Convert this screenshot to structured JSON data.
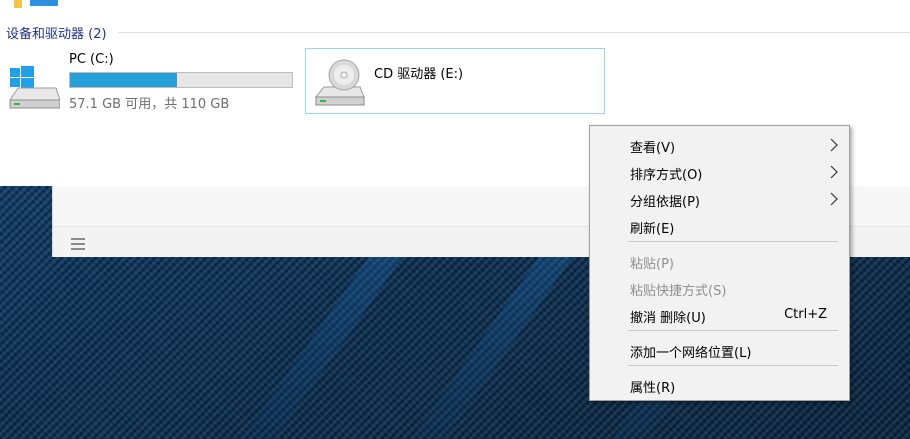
{
  "explorer": {
    "group_header": "设备和驱动器 (2)",
    "drives": [
      {
        "name": "PC (C:)",
        "space_text": "57.1 GB 可用，共 110 GB",
        "used_fraction": 0.48,
        "icon": "windows-drive-icon"
      },
      {
        "name": "CD 驱动器 (E:)",
        "icon": "cd-drive-icon"
      }
    ]
  },
  "context_menu": {
    "items": [
      {
        "label": "查看(V)",
        "has_submenu": true,
        "disabled": false
      },
      {
        "label": "排序方式(O)",
        "has_submenu": true,
        "disabled": false
      },
      {
        "label": "分组依据(P)",
        "has_submenu": true,
        "disabled": false
      },
      {
        "label": "刷新(E)",
        "has_submenu": false,
        "disabled": false
      },
      {
        "label": "粘贴(P)",
        "has_submenu": false,
        "disabled": true
      },
      {
        "label": "粘贴快捷方式(S)",
        "has_submenu": false,
        "disabled": true
      },
      {
        "label": "撤消 删除(U)",
        "shortcut": "Ctrl+Z",
        "has_submenu": false,
        "disabled": false
      },
      {
        "label": "添加一个网络位置(L)",
        "has_submenu": false,
        "disabled": false
      },
      {
        "label": "属性(R)",
        "has_submenu": false,
        "disabled": false
      }
    ]
  },
  "colors": {
    "accent_bar": "#26a0da",
    "group_header": "#1e3287",
    "selection_border": "#99d1ff",
    "desktop": "#0b2a4a"
  }
}
